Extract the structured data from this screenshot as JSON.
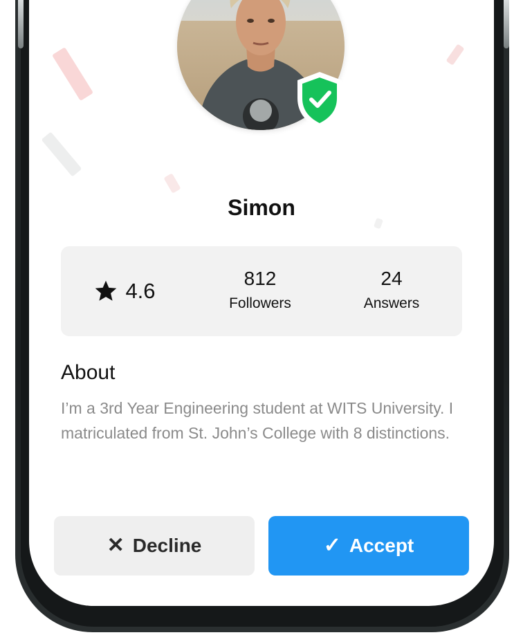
{
  "profile": {
    "name": "Simon",
    "verified": true,
    "avatar_alt": "profile-photo"
  },
  "stats": {
    "rating": "4.6",
    "followers_count": "812",
    "followers_label": "Followers",
    "answers_count": "24",
    "answers_label": "Answers"
  },
  "about": {
    "heading": "About",
    "text": "I’m a 3rd Year Engineering student at WITS University. I matriculated from St. John’s College with 8 distinctions."
  },
  "actions": {
    "decline_label": "Decline",
    "decline_glyph": "✕",
    "accept_label": "Accept",
    "accept_glyph": "✓"
  },
  "colors": {
    "accent": "#2196f3",
    "verified_green": "#16c25a",
    "decline_bg": "#efefef",
    "stats_bg": "#f2f2f2",
    "muted_text": "#8a8a8a"
  },
  "icons": {
    "rating": "star-icon",
    "verified": "shield-check-icon",
    "decline": "close-icon",
    "accept": "checkmark-icon"
  }
}
